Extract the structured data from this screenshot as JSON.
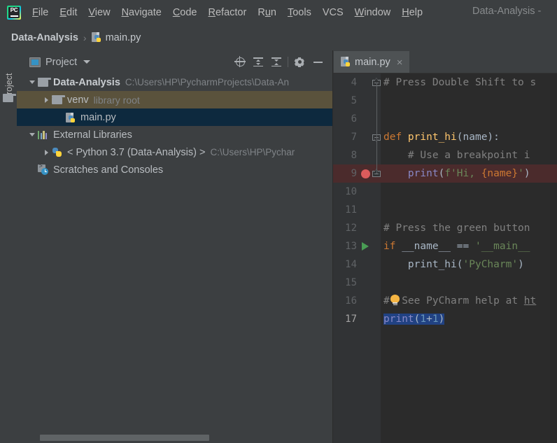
{
  "window": {
    "title": "Data-Analysis -",
    "app_icon": "pycharm-logo-icon",
    "logo_text": "PC"
  },
  "menubar": {
    "items": [
      {
        "label": "File",
        "mnemonic": "F"
      },
      {
        "label": "Edit",
        "mnemonic": "E"
      },
      {
        "label": "View",
        "mnemonic": "V"
      },
      {
        "label": "Navigate",
        "mnemonic": "N"
      },
      {
        "label": "Code",
        "mnemonic": "C"
      },
      {
        "label": "Refactor",
        "mnemonic": "R"
      },
      {
        "label": "Run",
        "mnemonic": "u"
      },
      {
        "label": "Tools",
        "mnemonic": "T"
      },
      {
        "label": "VCS",
        "mnemonic": ""
      },
      {
        "label": "Window",
        "mnemonic": "W"
      },
      {
        "label": "Help",
        "mnemonic": "H"
      }
    ]
  },
  "navbar": {
    "project": "Data-Analysis",
    "separator": "›",
    "file": "main.py"
  },
  "toolstrip": {
    "project_tab": "Project"
  },
  "project_panel": {
    "title": "Project",
    "actions": [
      {
        "name": "select-opened-file-icon"
      },
      {
        "name": "expand-all-icon"
      },
      {
        "name": "collapse-all-icon"
      },
      {
        "name": "settings-gear-icon"
      },
      {
        "name": "hide-panel-icon"
      }
    ],
    "tree": [
      {
        "label": "Data-Analysis",
        "detail": "C:\\Users\\HP\\PycharmProjects\\Data-An",
        "icon": "folder-icon",
        "arrow": "expanded",
        "indent": 0,
        "bold": true,
        "state": "none"
      },
      {
        "label": "venv",
        "detail": "library root",
        "icon": "folder-icon",
        "arrow": "collapsed",
        "indent": 1,
        "bold": false,
        "state": "excluded"
      },
      {
        "label": "main.py",
        "detail": "",
        "icon": "python-file-icon",
        "arrow": "none",
        "indent": 2,
        "bold": false,
        "state": "selected"
      },
      {
        "label": "External Libraries",
        "detail": "",
        "icon": "libraries-icon",
        "arrow": "expanded",
        "indent": 0,
        "bold": false,
        "state": "none"
      },
      {
        "label": "< Python 3.7 (Data-Analysis) >",
        "detail": "C:\\Users\\HP\\Pychar",
        "icon": "python-icon",
        "arrow": "collapsed",
        "indent": 1,
        "bold": false,
        "state": "none"
      },
      {
        "label": "Scratches and Consoles",
        "detail": "",
        "icon": "scratches-icon",
        "arrow": "none",
        "indent": 0,
        "bold": false,
        "state": "none"
      }
    ]
  },
  "editor": {
    "tab": {
      "label": "main.py",
      "icon": "python-file-icon",
      "close": "×"
    },
    "lines": [
      {
        "number": "4",
        "gutter": "fold-start",
        "tokens": [
          {
            "t": "# Press Double Shift to s",
            "c": "s-com"
          }
        ]
      },
      {
        "number": "5",
        "gutter": "fold-body",
        "tokens": []
      },
      {
        "number": "6",
        "gutter": "fold-body",
        "tokens": []
      },
      {
        "number": "7",
        "gutter": "fold-collapse",
        "tokens": [
          {
            "t": "def ",
            "c": "s-kw"
          },
          {
            "t": "print_hi",
            "c": "s-fn"
          },
          {
            "t": "(",
            "c": "s-def"
          },
          {
            "t": "name",
            "c": "s-param"
          },
          {
            "t": "):",
            "c": "s-def"
          }
        ]
      },
      {
        "number": "8",
        "gutter": "fold-body",
        "tokens": [
          {
            "t": "    # Use a breakpoint i",
            "c": "s-com"
          }
        ]
      },
      {
        "number": "9",
        "gutter": "fold-end",
        "breakpoint": true,
        "highlight": true,
        "tokens": [
          {
            "t": "    ",
            "c": "s-def"
          },
          {
            "t": "print",
            "c": "s-builtin"
          },
          {
            "t": "(",
            "c": "s-def"
          },
          {
            "t": "f'Hi, ",
            "c": "s-str"
          },
          {
            "t": "{name}",
            "c": "s-kw"
          },
          {
            "t": "'",
            "c": "s-str"
          },
          {
            "t": ")",
            "c": "s-def"
          }
        ]
      },
      {
        "number": "10",
        "tokens": []
      },
      {
        "number": "11",
        "tokens": []
      },
      {
        "number": "12",
        "tokens": [
          {
            "t": "# Press the green button",
            "c": "s-com"
          }
        ]
      },
      {
        "number": "13",
        "runmarker": true,
        "tokens": [
          {
            "t": "if ",
            "c": "s-kw"
          },
          {
            "t": "__name__ == ",
            "c": "s-def"
          },
          {
            "t": "'__main__",
            "c": "s-str"
          }
        ]
      },
      {
        "number": "14",
        "tokens": [
          {
            "t": "    ",
            "c": "s-def"
          },
          {
            "t": "print_hi",
            "c": "s-def"
          },
          {
            "t": "(",
            "c": "s-def"
          },
          {
            "t": "'PyCharm'",
            "c": "s-str"
          },
          {
            "t": ")",
            "c": "s-def"
          }
        ]
      },
      {
        "number": "15",
        "tokens": []
      },
      {
        "number": "16",
        "bulb": true,
        "tokens": [
          {
            "t": "#  See PyCharm help at ",
            "c": "s-com"
          },
          {
            "t": "ht",
            "c": "s-lnk"
          }
        ]
      },
      {
        "number": "17",
        "current": true,
        "selection": true,
        "tokens": [
          {
            "t": "print",
            "c": "s-builtin"
          },
          {
            "t": "(",
            "c": "s-def"
          },
          {
            "t": "1",
            "c": "s-num"
          },
          {
            "t": "+",
            "c": "s-def"
          },
          {
            "t": "1",
            "c": "s-num"
          },
          {
            "t": ")",
            "c": "s-def"
          }
        ]
      }
    ]
  },
  "colors": {
    "chrome": "#3c3f41",
    "editor_bg": "#2b2b2b",
    "gutter_bg": "#313335",
    "tree_selection": "#0d293e",
    "tree_excluded": "#5a523c",
    "breakpoint": "#db5c5c",
    "run_marker": "#499c54",
    "text_selection": "#214283",
    "comment": "#808080",
    "keyword": "#cc7832",
    "string": "#6a8759",
    "number": "#6897bb",
    "function": "#ffc66d",
    "default_text": "#a9b7c6"
  }
}
